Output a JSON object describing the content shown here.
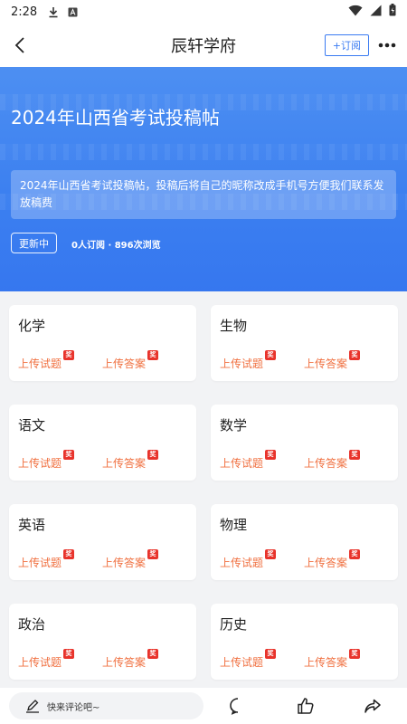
{
  "status_bar": {
    "time": "2:28"
  },
  "nav": {
    "title": "辰轩学府",
    "subscribe_label": "+订阅"
  },
  "banner": {
    "title": "2024年山西省考试投稿帖",
    "description": "2024年山西省考试投稿帖，投稿后将自己的昵称改成手机号方便我们联系发放稿费",
    "status": "更新中",
    "stats": "0人订阅 · 896次浏览"
  },
  "subjects": [
    {
      "name": "化学",
      "upload_question": "上传试题",
      "upload_answer": "上传答案",
      "badge": "奖"
    },
    {
      "name": "生物",
      "upload_question": "上传试题",
      "upload_answer": "上传答案",
      "badge": "奖"
    },
    {
      "name": "语文",
      "upload_question": "上传试题",
      "upload_answer": "上传答案",
      "badge": "奖"
    },
    {
      "name": "数学",
      "upload_question": "上传试题",
      "upload_answer": "上传答案",
      "badge": "奖"
    },
    {
      "name": "英语",
      "upload_question": "上传试题",
      "upload_answer": "上传答案",
      "badge": "奖"
    },
    {
      "name": "物理",
      "upload_question": "上传试题",
      "upload_answer": "上传答案",
      "badge": "奖"
    },
    {
      "name": "政治",
      "upload_question": "上传试题",
      "upload_answer": "上传答案",
      "badge": "奖"
    },
    {
      "name": "历史",
      "upload_question": "上传试题",
      "upload_answer": "上传答案",
      "badge": "奖"
    }
  ],
  "bottom_bar": {
    "comment_placeholder": "快来评论吧~"
  },
  "icons": {
    "status": [
      "download-icon",
      "app-notification-icon",
      "wifi-icon",
      "signal-icon",
      "battery-icon"
    ],
    "nav": [
      "back-icon",
      "more-icon"
    ],
    "bottom": [
      "pen-icon",
      "comment-icon",
      "like-icon",
      "share-icon"
    ]
  },
  "colors": {
    "accent": "#3a7bf2",
    "banner": "#3b7ff0",
    "upload_text": "#f07040",
    "badge": "#e8332b"
  }
}
